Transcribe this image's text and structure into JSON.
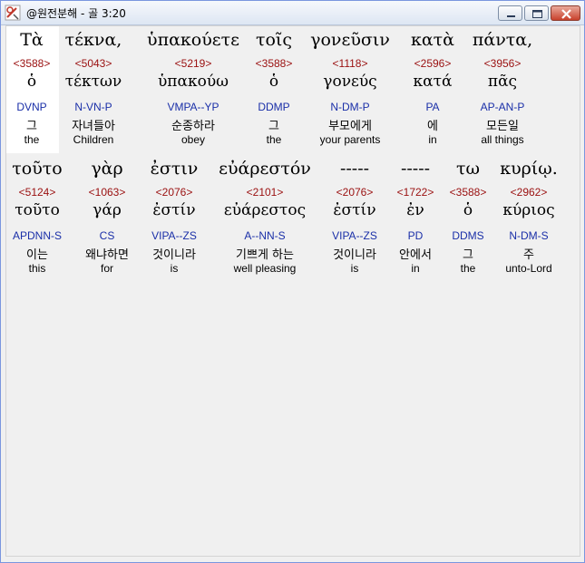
{
  "window": {
    "title": "@원전분해 - 골 3:20"
  },
  "rows": [
    {
      "words": [
        {
          "greek": "Τὰ",
          "strong": "<3588>",
          "lemma": "ὁ",
          "parse": "DVNP",
          "korean": "그",
          "english": "the"
        },
        {
          "greek": "τέκνα,",
          "strong": "<5043>",
          "lemma": "τέκτων",
          "parse": "N-VN-P",
          "korean": "자녀들아",
          "english": "Children"
        },
        {
          "greek": "ὑπακούετε",
          "strong": "<5219>",
          "lemma": "ὑπακούω",
          "parse": "VMPA--YP",
          "korean": "순종하라",
          "english": "obey"
        },
        {
          "greek": "τοῖς",
          "strong": "<3588>",
          "lemma": "ὁ",
          "parse": "DDMP",
          "korean": "그",
          "english": "the"
        },
        {
          "greek": "γονεῦσιν",
          "strong": "<1118>",
          "lemma": "γονεύς",
          "parse": "N-DM-P",
          "korean": "부모에게",
          "english": "your parents"
        },
        {
          "greek": "κατὰ",
          "strong": "<2596>",
          "lemma": "κατά",
          "parse": "PA",
          "korean": "에",
          "english": "in"
        },
        {
          "greek": "πάντα,",
          "strong": "<3956>",
          "lemma": "πᾶς",
          "parse": "AP-AN-P",
          "korean": "모든일",
          "english": "all things"
        }
      ]
    },
    {
      "words": [
        {
          "greek": "τοῦτο",
          "strong": "<5124>",
          "lemma": "τοῦτο",
          "parse": "APDNN-S",
          "korean": "이는",
          "english": "this"
        },
        {
          "greek": "γὰρ",
          "strong": "<1063>",
          "lemma": "γάρ",
          "parse": "CS",
          "korean": "왜냐하면",
          "english": "for"
        },
        {
          "greek": "ἐστιν",
          "strong": "<2076>",
          "lemma": "ἐστίν",
          "parse": "VIPA--ZS",
          "korean": "것이니라",
          "english": "is"
        },
        {
          "greek": "εὐάρεστόν",
          "strong": "<2101>",
          "lemma": "εὐάρεστος",
          "parse": "A--NN-S",
          "korean": "기쁘게 하는",
          "english": "well pleasing"
        },
        {
          "greek": "-----",
          "strong": "<2076>",
          "lemma": "ἐστίν",
          "parse": "VIPA--ZS",
          "korean": "것이니라",
          "english": "is"
        },
        {
          "greek": "-----",
          "strong": "<1722>",
          "lemma": "ἐν",
          "parse": "PD",
          "korean": "안에서",
          "english": "in"
        },
        {
          "greek": "τω",
          "strong": "<3588>",
          "lemma": "ὁ",
          "parse": "DDMS",
          "korean": "그",
          "english": "the"
        },
        {
          "greek": "κυρίῳ.",
          "strong": "<2962>",
          "lemma": "κύριος",
          "parse": "N-DM-S",
          "korean": "주",
          "english": "unto-Lord"
        }
      ]
    }
  ]
}
